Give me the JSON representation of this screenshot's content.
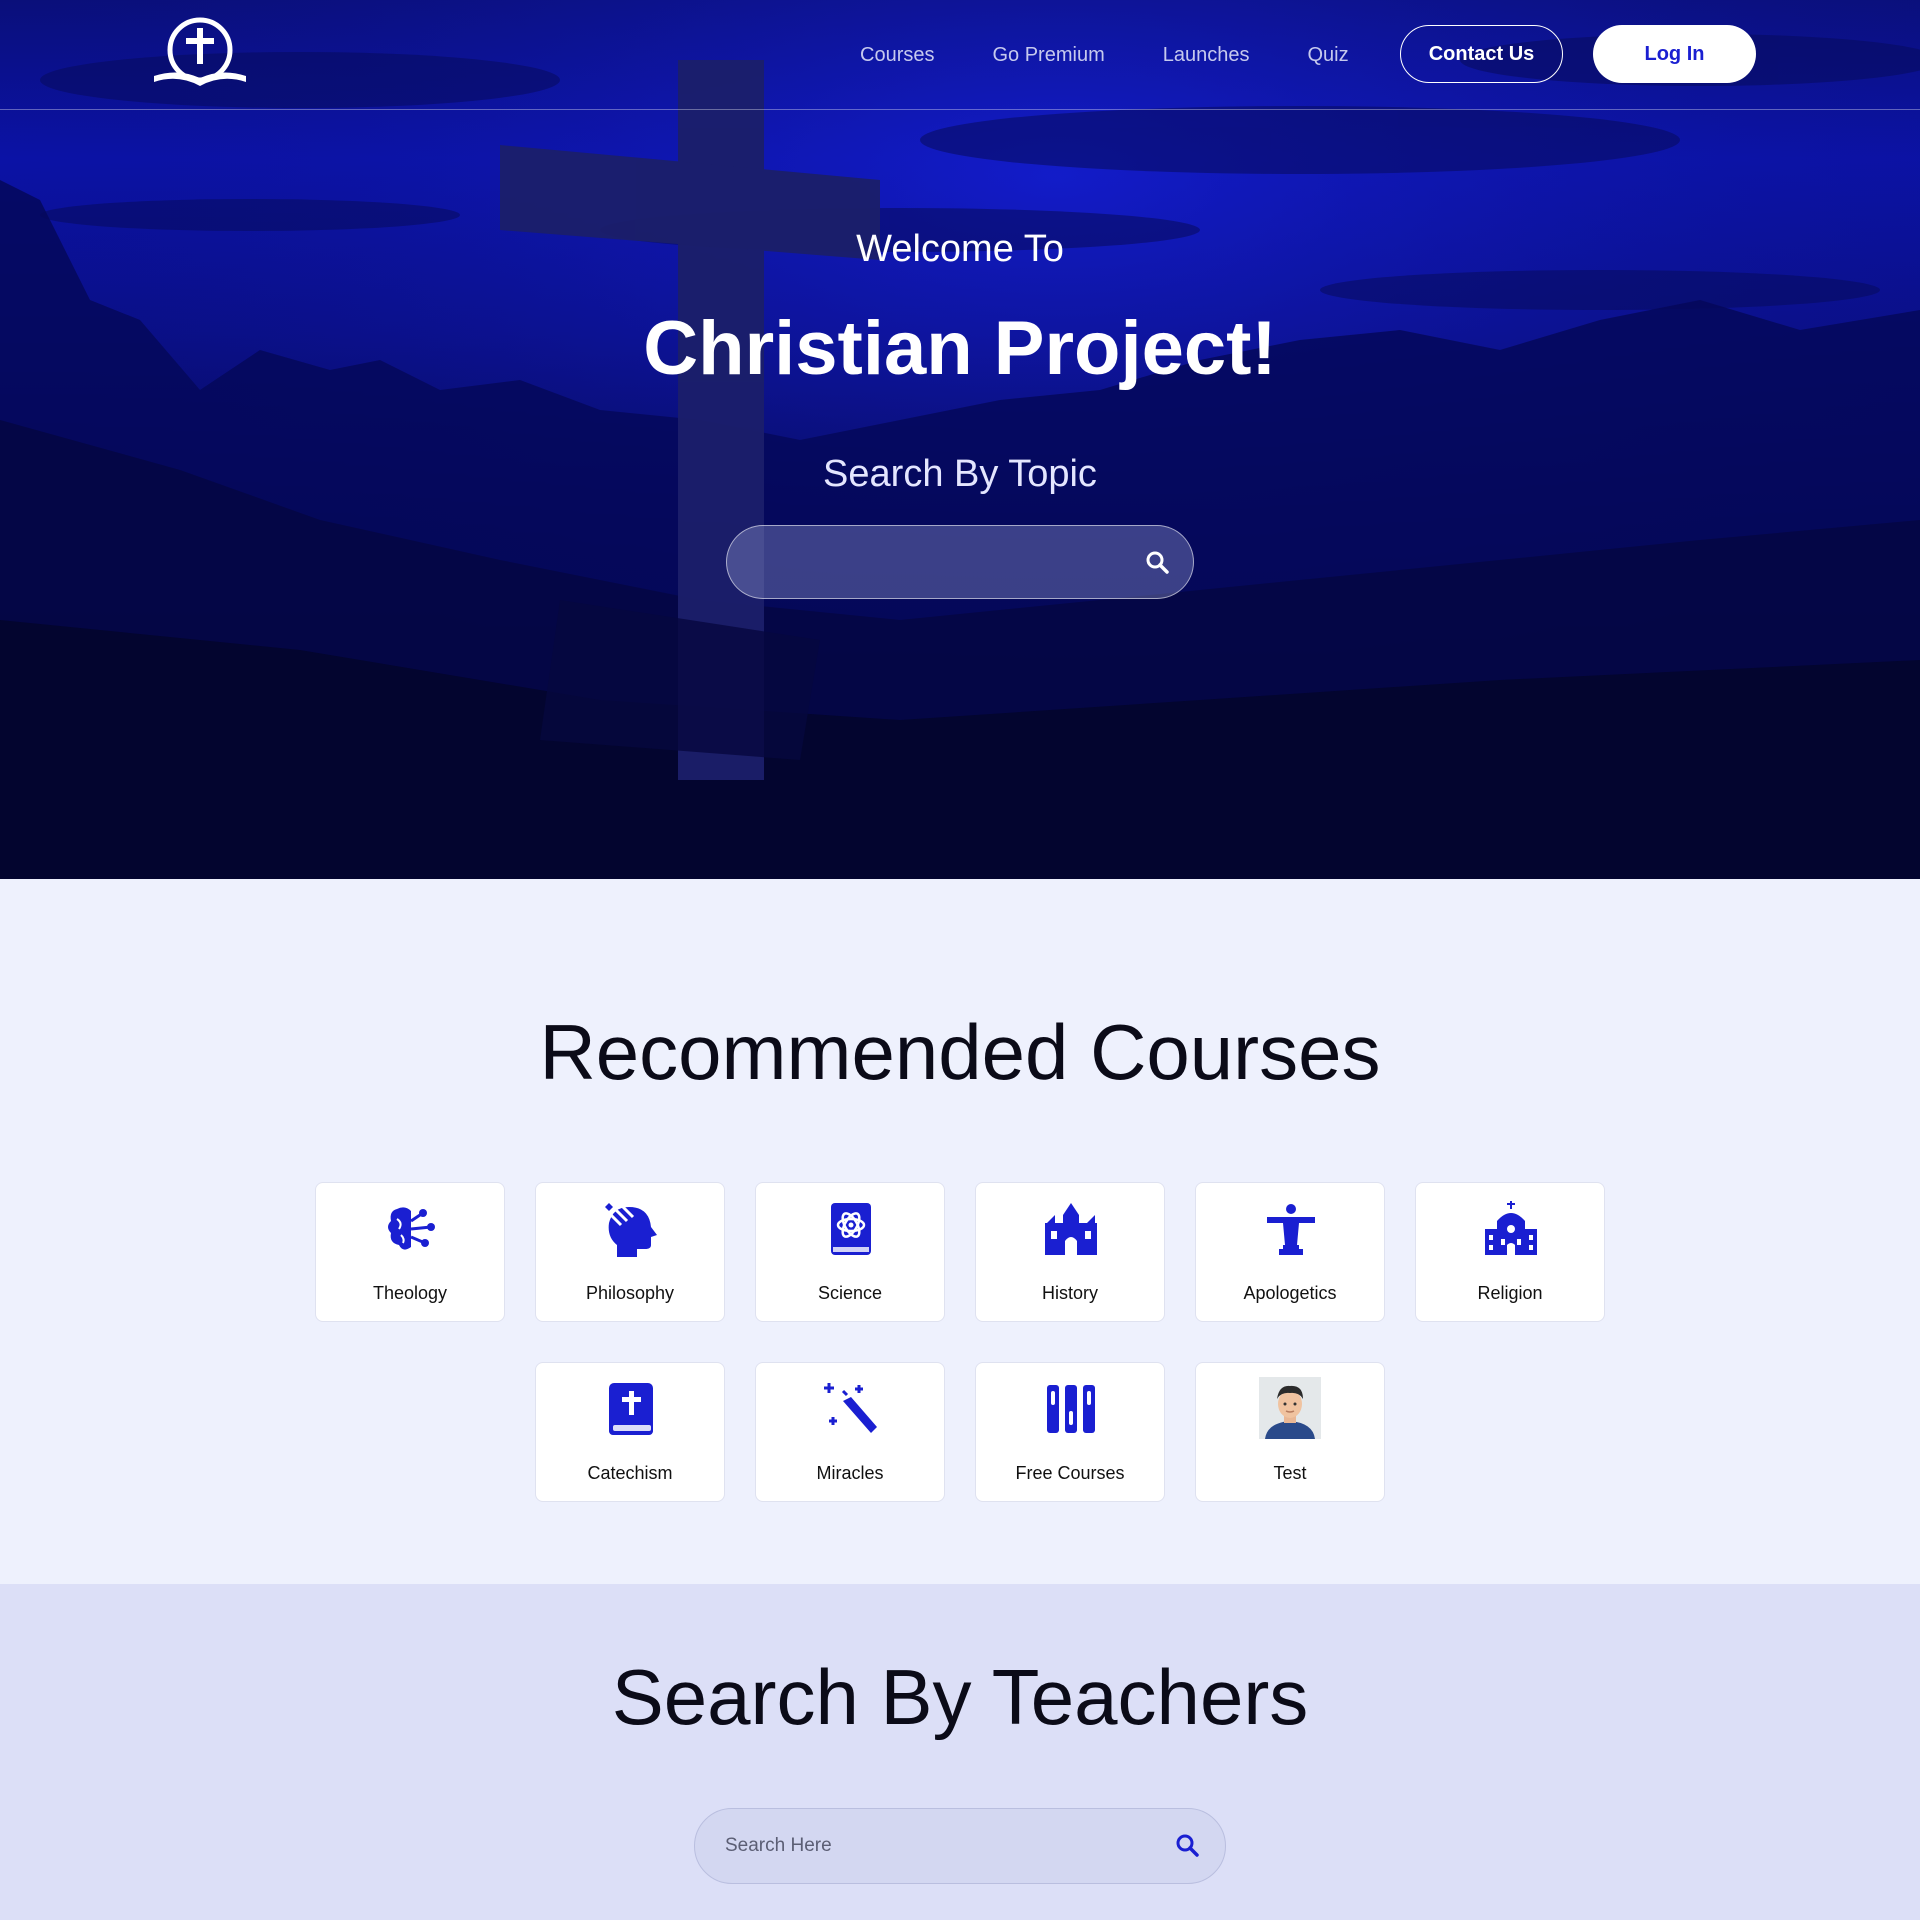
{
  "nav": {
    "links": [
      "Courses",
      "Go Premium",
      "Launches",
      "Quiz"
    ],
    "contact_label": "Contact Us",
    "login_label": "Log In"
  },
  "hero": {
    "welcome": "Welcome To",
    "title": "Christian Project!",
    "search_label": "Search By Topic"
  },
  "recommended": {
    "title": "Recommended Courses",
    "courses": [
      {
        "label": "Theology",
        "icon": "brain-icon"
      },
      {
        "label": "Philosophy",
        "icon": "head-thought-icon"
      },
      {
        "label": "Science",
        "icon": "atom-book-icon"
      },
      {
        "label": "History",
        "icon": "castle-icon"
      },
      {
        "label": "Apologetics",
        "icon": "christ-statue-icon"
      },
      {
        "label": "Religion",
        "icon": "church-icon"
      },
      {
        "label": "Catechism",
        "icon": "bible-icon"
      },
      {
        "label": "Miracles",
        "icon": "magic-wand-icon"
      },
      {
        "label": "Free Courses",
        "icon": "books-icon"
      },
      {
        "label": "Test",
        "icon": "avatar-image"
      }
    ]
  },
  "teachers": {
    "title": "Search By Teachers",
    "search_placeholder": "Search Here"
  },
  "colors": {
    "accent": "#1a1fd1",
    "hero_dark": "#060a55",
    "section_light": "#eef1fd",
    "section_teachers": "#dcdff7"
  }
}
